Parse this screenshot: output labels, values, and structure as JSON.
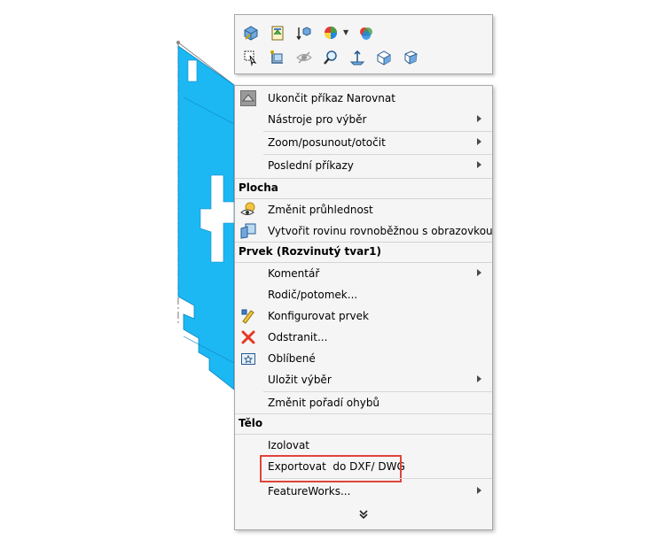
{
  "toolbar": {
    "row1": [
      {
        "icon": "view-orientation-icon"
      },
      {
        "icon": "display-style-icon"
      },
      {
        "icon": "section-view-icon"
      },
      {
        "icon": "appearance-icon",
        "has_dropdown": true
      },
      {
        "icon": "scene-icon"
      }
    ],
    "row2": [
      {
        "icon": "zoom-to-selection-icon"
      },
      {
        "icon": "normal-to-icon"
      },
      {
        "icon": "hide-show-icon"
      },
      {
        "icon": "zoom-icon"
      },
      {
        "icon": "measure-icon"
      },
      {
        "icon": "isometric-view-icon"
      },
      {
        "icon": "trimetric-view-icon"
      }
    ]
  },
  "menu": {
    "items_top": [
      {
        "label": "Ukončit příkaz Narovnat",
        "submenu": false,
        "icon": "unfold-icon"
      },
      {
        "label": "Nástroje pro výběr",
        "submenu": true
      },
      {
        "label": "Zoom/posunout/otočit",
        "submenu": true
      },
      {
        "label": "Poslední příkazy",
        "submenu": true
      }
    ],
    "sections": [
      {
        "header": "Plocha",
        "items": [
          {
            "label": "Změnit průhlednost",
            "submenu": false,
            "icon": "transparency-icon"
          },
          {
            "label": "Vytvořit rovinu rovnoběžnou s obrazovkou",
            "submenu": false,
            "icon": "plane-icon"
          }
        ]
      },
      {
        "header": "Prvek (Rozvinutý tvar1)",
        "items": [
          {
            "label": "Komentář",
            "submenu": true
          },
          {
            "label": "Rodič/potomek...",
            "submenu": false
          },
          {
            "label": "Konfigurovat prvek",
            "submenu": false,
            "icon": "configure-icon"
          },
          {
            "label": "Odstranit...",
            "submenu": false,
            "icon": "delete-icon"
          },
          {
            "label": "Oblíbené",
            "submenu": false,
            "icon": "favorites-icon"
          },
          {
            "label": "Uložit výběr",
            "submenu": true
          },
          {
            "label": "Změnit pořadí ohybů",
            "submenu": false
          }
        ]
      },
      {
        "header": "Tělo",
        "items": [
          {
            "label": "Izolovat",
            "submenu": false
          },
          {
            "label": "Exportovat  do DXF/ DWG",
            "submenu": false,
            "highlighted": true
          },
          {
            "label": "FeatureWorks...",
            "submenu": true
          }
        ]
      }
    ],
    "more_icon": "double-chevron-down-icon"
  },
  "colors": {
    "part_fill": "#1cb8f4",
    "highlight_border": "#e0433a",
    "menu_bg": "#f5f5f5"
  }
}
